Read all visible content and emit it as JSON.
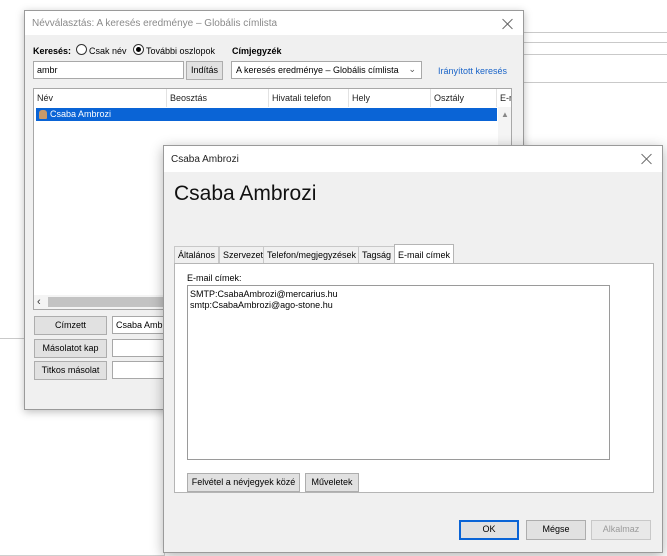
{
  "dialog1": {
    "title": "Névválasztás: A keresés eredménye – Globális címlista",
    "search_label": "Keresés:",
    "radio_name_only": "Csak név",
    "radio_more_columns": "További oszlopok",
    "address_book_label": "Címjegyzék",
    "search_value": "ambr",
    "go_button": "Indítás",
    "address_book_value": "A keresés eredménye – Globális címlista",
    "advanced_find_link": "Irányított keresés",
    "columns": [
      "Név",
      "Beosztás",
      "Hivatali telefon",
      "Hely",
      "Osztály",
      "E-n"
    ],
    "rows": [
      {
        "name": "Csaba Ambrozi"
      }
    ],
    "to_button": "Címzett",
    "to_value": "Csaba Ambr",
    "cc_button": "Másolatot kap",
    "bcc_button": "Titkos másolat"
  },
  "dialog2": {
    "title": "Csaba Ambrozi",
    "heading": "Csaba Ambrozi",
    "tabs": [
      "Általános",
      "Szervezet",
      "Telefon/megjegyzések",
      "Tagság",
      "E-mail címek"
    ],
    "email_label": "E-mail címek:",
    "emails": [
      "SMTP:CsabaAmbrozi@mercarius.hu",
      "smtp:CsabaAmbrozi@ago-stone.hu"
    ],
    "add_to_contacts_button": "Felvétel a névjegyek közé",
    "actions_button": "Műveletek",
    "ok_button": "OK",
    "cancel_button": "Mégse",
    "apply_button": "Alkalmaz"
  }
}
